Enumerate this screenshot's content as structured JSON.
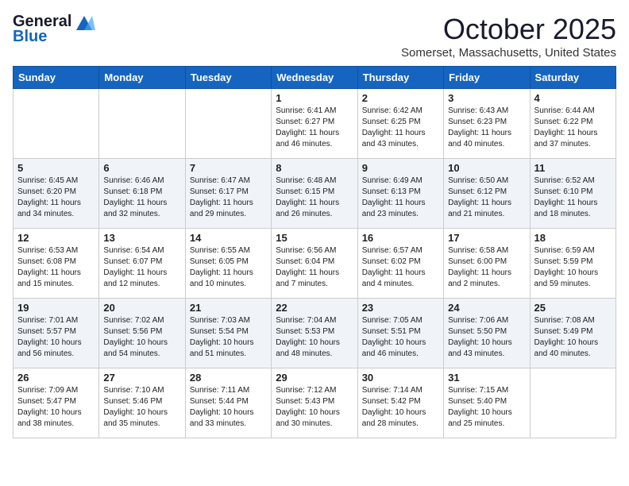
{
  "header": {
    "logo_general": "General",
    "logo_blue": "Blue",
    "month": "October 2025",
    "location": "Somerset, Massachusetts, United States"
  },
  "days_of_week": [
    "Sunday",
    "Monday",
    "Tuesday",
    "Wednesday",
    "Thursday",
    "Friday",
    "Saturday"
  ],
  "weeks": [
    [
      {
        "day": "",
        "text": ""
      },
      {
        "day": "",
        "text": ""
      },
      {
        "day": "",
        "text": ""
      },
      {
        "day": "1",
        "text": "Sunrise: 6:41 AM\nSunset: 6:27 PM\nDaylight: 11 hours and 46 minutes."
      },
      {
        "day": "2",
        "text": "Sunrise: 6:42 AM\nSunset: 6:25 PM\nDaylight: 11 hours and 43 minutes."
      },
      {
        "day": "3",
        "text": "Sunrise: 6:43 AM\nSunset: 6:23 PM\nDaylight: 11 hours and 40 minutes."
      },
      {
        "day": "4",
        "text": "Sunrise: 6:44 AM\nSunset: 6:22 PM\nDaylight: 11 hours and 37 minutes."
      }
    ],
    [
      {
        "day": "5",
        "text": "Sunrise: 6:45 AM\nSunset: 6:20 PM\nDaylight: 11 hours and 34 minutes."
      },
      {
        "day": "6",
        "text": "Sunrise: 6:46 AM\nSunset: 6:18 PM\nDaylight: 11 hours and 32 minutes."
      },
      {
        "day": "7",
        "text": "Sunrise: 6:47 AM\nSunset: 6:17 PM\nDaylight: 11 hours and 29 minutes."
      },
      {
        "day": "8",
        "text": "Sunrise: 6:48 AM\nSunset: 6:15 PM\nDaylight: 11 hours and 26 minutes."
      },
      {
        "day": "9",
        "text": "Sunrise: 6:49 AM\nSunset: 6:13 PM\nDaylight: 11 hours and 23 minutes."
      },
      {
        "day": "10",
        "text": "Sunrise: 6:50 AM\nSunset: 6:12 PM\nDaylight: 11 hours and 21 minutes."
      },
      {
        "day": "11",
        "text": "Sunrise: 6:52 AM\nSunset: 6:10 PM\nDaylight: 11 hours and 18 minutes."
      }
    ],
    [
      {
        "day": "12",
        "text": "Sunrise: 6:53 AM\nSunset: 6:08 PM\nDaylight: 11 hours and 15 minutes."
      },
      {
        "day": "13",
        "text": "Sunrise: 6:54 AM\nSunset: 6:07 PM\nDaylight: 11 hours and 12 minutes."
      },
      {
        "day": "14",
        "text": "Sunrise: 6:55 AM\nSunset: 6:05 PM\nDaylight: 11 hours and 10 minutes."
      },
      {
        "day": "15",
        "text": "Sunrise: 6:56 AM\nSunset: 6:04 PM\nDaylight: 11 hours and 7 minutes."
      },
      {
        "day": "16",
        "text": "Sunrise: 6:57 AM\nSunset: 6:02 PM\nDaylight: 11 hours and 4 minutes."
      },
      {
        "day": "17",
        "text": "Sunrise: 6:58 AM\nSunset: 6:00 PM\nDaylight: 11 hours and 2 minutes."
      },
      {
        "day": "18",
        "text": "Sunrise: 6:59 AM\nSunset: 5:59 PM\nDaylight: 10 hours and 59 minutes."
      }
    ],
    [
      {
        "day": "19",
        "text": "Sunrise: 7:01 AM\nSunset: 5:57 PM\nDaylight: 10 hours and 56 minutes."
      },
      {
        "day": "20",
        "text": "Sunrise: 7:02 AM\nSunset: 5:56 PM\nDaylight: 10 hours and 54 minutes."
      },
      {
        "day": "21",
        "text": "Sunrise: 7:03 AM\nSunset: 5:54 PM\nDaylight: 10 hours and 51 minutes."
      },
      {
        "day": "22",
        "text": "Sunrise: 7:04 AM\nSunset: 5:53 PM\nDaylight: 10 hours and 48 minutes."
      },
      {
        "day": "23",
        "text": "Sunrise: 7:05 AM\nSunset: 5:51 PM\nDaylight: 10 hours and 46 minutes."
      },
      {
        "day": "24",
        "text": "Sunrise: 7:06 AM\nSunset: 5:50 PM\nDaylight: 10 hours and 43 minutes."
      },
      {
        "day": "25",
        "text": "Sunrise: 7:08 AM\nSunset: 5:49 PM\nDaylight: 10 hours and 40 minutes."
      }
    ],
    [
      {
        "day": "26",
        "text": "Sunrise: 7:09 AM\nSunset: 5:47 PM\nDaylight: 10 hours and 38 minutes."
      },
      {
        "day": "27",
        "text": "Sunrise: 7:10 AM\nSunset: 5:46 PM\nDaylight: 10 hours and 35 minutes."
      },
      {
        "day": "28",
        "text": "Sunrise: 7:11 AM\nSunset: 5:44 PM\nDaylight: 10 hours and 33 minutes."
      },
      {
        "day": "29",
        "text": "Sunrise: 7:12 AM\nSunset: 5:43 PM\nDaylight: 10 hours and 30 minutes."
      },
      {
        "day": "30",
        "text": "Sunrise: 7:14 AM\nSunset: 5:42 PM\nDaylight: 10 hours and 28 minutes."
      },
      {
        "day": "31",
        "text": "Sunrise: 7:15 AM\nSunset: 5:40 PM\nDaylight: 10 hours and 25 minutes."
      },
      {
        "day": "",
        "text": ""
      }
    ]
  ]
}
